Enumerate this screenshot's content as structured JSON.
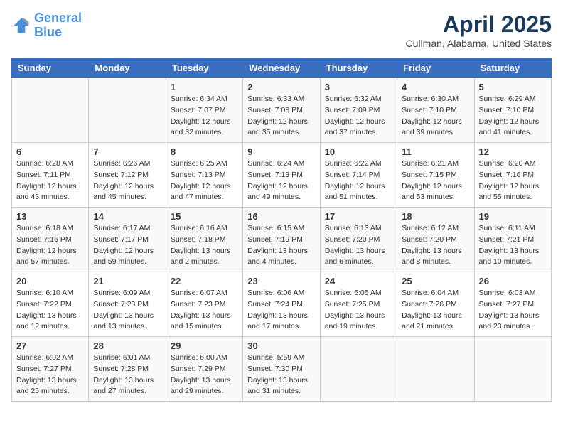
{
  "header": {
    "logo_line1": "General",
    "logo_line2": "Blue",
    "month": "April 2025",
    "location": "Cullman, Alabama, United States"
  },
  "weekdays": [
    "Sunday",
    "Monday",
    "Tuesday",
    "Wednesday",
    "Thursday",
    "Friday",
    "Saturday"
  ],
  "weeks": [
    [
      {
        "day": "",
        "sunrise": "",
        "sunset": "",
        "daylight": ""
      },
      {
        "day": "",
        "sunrise": "",
        "sunset": "",
        "daylight": ""
      },
      {
        "day": "1",
        "sunrise": "Sunrise: 6:34 AM",
        "sunset": "Sunset: 7:07 PM",
        "daylight": "Daylight: 12 hours and 32 minutes."
      },
      {
        "day": "2",
        "sunrise": "Sunrise: 6:33 AM",
        "sunset": "Sunset: 7:08 PM",
        "daylight": "Daylight: 12 hours and 35 minutes."
      },
      {
        "day": "3",
        "sunrise": "Sunrise: 6:32 AM",
        "sunset": "Sunset: 7:09 PM",
        "daylight": "Daylight: 12 hours and 37 minutes."
      },
      {
        "day": "4",
        "sunrise": "Sunrise: 6:30 AM",
        "sunset": "Sunset: 7:10 PM",
        "daylight": "Daylight: 12 hours and 39 minutes."
      },
      {
        "day": "5",
        "sunrise": "Sunrise: 6:29 AM",
        "sunset": "Sunset: 7:10 PM",
        "daylight": "Daylight: 12 hours and 41 minutes."
      }
    ],
    [
      {
        "day": "6",
        "sunrise": "Sunrise: 6:28 AM",
        "sunset": "Sunset: 7:11 PM",
        "daylight": "Daylight: 12 hours and 43 minutes."
      },
      {
        "day": "7",
        "sunrise": "Sunrise: 6:26 AM",
        "sunset": "Sunset: 7:12 PM",
        "daylight": "Daylight: 12 hours and 45 minutes."
      },
      {
        "day": "8",
        "sunrise": "Sunrise: 6:25 AM",
        "sunset": "Sunset: 7:13 PM",
        "daylight": "Daylight: 12 hours and 47 minutes."
      },
      {
        "day": "9",
        "sunrise": "Sunrise: 6:24 AM",
        "sunset": "Sunset: 7:13 PM",
        "daylight": "Daylight: 12 hours and 49 minutes."
      },
      {
        "day": "10",
        "sunrise": "Sunrise: 6:22 AM",
        "sunset": "Sunset: 7:14 PM",
        "daylight": "Daylight: 12 hours and 51 minutes."
      },
      {
        "day": "11",
        "sunrise": "Sunrise: 6:21 AM",
        "sunset": "Sunset: 7:15 PM",
        "daylight": "Daylight: 12 hours and 53 minutes."
      },
      {
        "day": "12",
        "sunrise": "Sunrise: 6:20 AM",
        "sunset": "Sunset: 7:16 PM",
        "daylight": "Daylight: 12 hours and 55 minutes."
      }
    ],
    [
      {
        "day": "13",
        "sunrise": "Sunrise: 6:18 AM",
        "sunset": "Sunset: 7:16 PM",
        "daylight": "Daylight: 12 hours and 57 minutes."
      },
      {
        "day": "14",
        "sunrise": "Sunrise: 6:17 AM",
        "sunset": "Sunset: 7:17 PM",
        "daylight": "Daylight: 12 hours and 59 minutes."
      },
      {
        "day": "15",
        "sunrise": "Sunrise: 6:16 AM",
        "sunset": "Sunset: 7:18 PM",
        "daylight": "Daylight: 13 hours and 2 minutes."
      },
      {
        "day": "16",
        "sunrise": "Sunrise: 6:15 AM",
        "sunset": "Sunset: 7:19 PM",
        "daylight": "Daylight: 13 hours and 4 minutes."
      },
      {
        "day": "17",
        "sunrise": "Sunrise: 6:13 AM",
        "sunset": "Sunset: 7:20 PM",
        "daylight": "Daylight: 13 hours and 6 minutes."
      },
      {
        "day": "18",
        "sunrise": "Sunrise: 6:12 AM",
        "sunset": "Sunset: 7:20 PM",
        "daylight": "Daylight: 13 hours and 8 minutes."
      },
      {
        "day": "19",
        "sunrise": "Sunrise: 6:11 AM",
        "sunset": "Sunset: 7:21 PM",
        "daylight": "Daylight: 13 hours and 10 minutes."
      }
    ],
    [
      {
        "day": "20",
        "sunrise": "Sunrise: 6:10 AM",
        "sunset": "Sunset: 7:22 PM",
        "daylight": "Daylight: 13 hours and 12 minutes."
      },
      {
        "day": "21",
        "sunrise": "Sunrise: 6:09 AM",
        "sunset": "Sunset: 7:23 PM",
        "daylight": "Daylight: 13 hours and 13 minutes."
      },
      {
        "day": "22",
        "sunrise": "Sunrise: 6:07 AM",
        "sunset": "Sunset: 7:23 PM",
        "daylight": "Daylight: 13 hours and 15 minutes."
      },
      {
        "day": "23",
        "sunrise": "Sunrise: 6:06 AM",
        "sunset": "Sunset: 7:24 PM",
        "daylight": "Daylight: 13 hours and 17 minutes."
      },
      {
        "day": "24",
        "sunrise": "Sunrise: 6:05 AM",
        "sunset": "Sunset: 7:25 PM",
        "daylight": "Daylight: 13 hours and 19 minutes."
      },
      {
        "day": "25",
        "sunrise": "Sunrise: 6:04 AM",
        "sunset": "Sunset: 7:26 PM",
        "daylight": "Daylight: 13 hours and 21 minutes."
      },
      {
        "day": "26",
        "sunrise": "Sunrise: 6:03 AM",
        "sunset": "Sunset: 7:27 PM",
        "daylight": "Daylight: 13 hours and 23 minutes."
      }
    ],
    [
      {
        "day": "27",
        "sunrise": "Sunrise: 6:02 AM",
        "sunset": "Sunset: 7:27 PM",
        "daylight": "Daylight: 13 hours and 25 minutes."
      },
      {
        "day": "28",
        "sunrise": "Sunrise: 6:01 AM",
        "sunset": "Sunset: 7:28 PM",
        "daylight": "Daylight: 13 hours and 27 minutes."
      },
      {
        "day": "29",
        "sunrise": "Sunrise: 6:00 AM",
        "sunset": "Sunset: 7:29 PM",
        "daylight": "Daylight: 13 hours and 29 minutes."
      },
      {
        "day": "30",
        "sunrise": "Sunrise: 5:59 AM",
        "sunset": "Sunset: 7:30 PM",
        "daylight": "Daylight: 13 hours and 31 minutes."
      },
      {
        "day": "",
        "sunrise": "",
        "sunset": "",
        "daylight": ""
      },
      {
        "day": "",
        "sunrise": "",
        "sunset": "",
        "daylight": ""
      },
      {
        "day": "",
        "sunrise": "",
        "sunset": "",
        "daylight": ""
      }
    ]
  ]
}
